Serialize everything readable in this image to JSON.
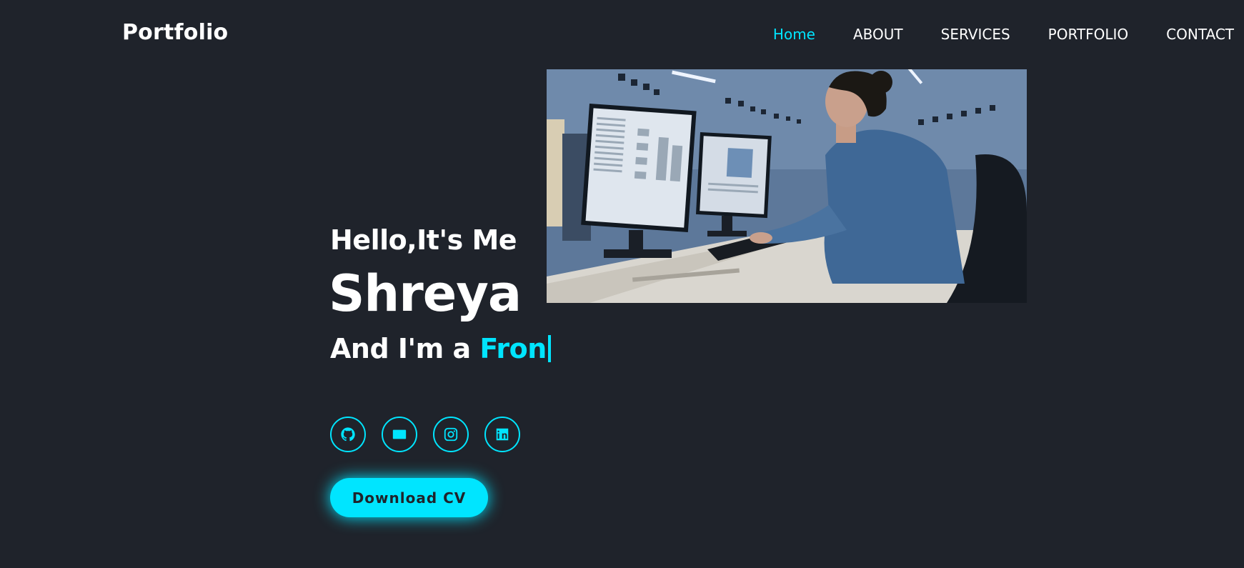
{
  "header": {
    "logo": "Portfolio",
    "nav": [
      {
        "label": "Home",
        "active": true
      },
      {
        "label": "ABOUT",
        "active": false
      },
      {
        "label": "SERVICES",
        "active": false
      },
      {
        "label": "PORTFOLIO",
        "active": false
      },
      {
        "label": "CONTACT",
        "active": false
      }
    ]
  },
  "hero": {
    "greeting": "Hello,It's Me",
    "name": "Shreya",
    "role_prefix": "And I'm a",
    "role_typed": "Fron",
    "image_alt": "woman working at computer workstation",
    "socials": [
      {
        "icon": "github-icon"
      },
      {
        "icon": "mail-icon"
      },
      {
        "icon": "instagram-icon"
      },
      {
        "icon": "linkedin-icon"
      }
    ],
    "download_label": "Download CV"
  },
  "colors": {
    "background": "#1f232b",
    "accent": "#00e5ff",
    "text": "#ffffff"
  }
}
